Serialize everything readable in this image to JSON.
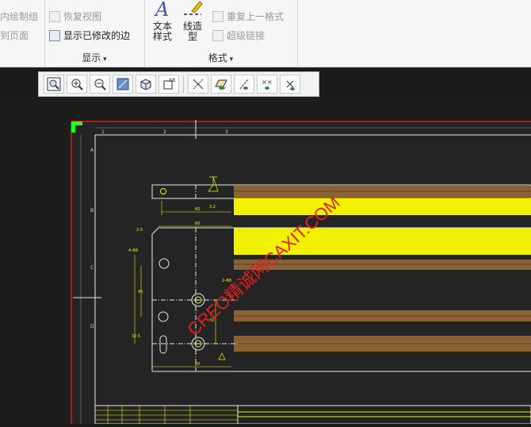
{
  "ribbon": {
    "left_items": [
      "内绘制组",
      "到页面"
    ],
    "display": {
      "label": "显示",
      "items": [
        "恢复视图",
        "显示已修改的边"
      ]
    },
    "format": {
      "label": "格式",
      "text_style": "文本\n样式",
      "line_type": "线造\n型",
      "items": [
        "重复上一格式",
        "超级链接"
      ]
    }
  },
  "view_toolbar": {
    "tools": [
      "zoom-fit-icon",
      "zoom-in-icon",
      "zoom-out-icon",
      "repaint-icon",
      "display-style-icon",
      "saved-views-icon",
      "datum-display-icon",
      "datum-plane-icon",
      "datum-axis-icon",
      "datum-point-icon",
      "coordinate-system-icon"
    ]
  },
  "drawing": {
    "border_numbers": [
      "1",
      "2",
      "3"
    ],
    "border_letters": [
      "A",
      "B",
      "C",
      "D"
    ],
    "dimensions": [
      "3.2",
      "60",
      "60",
      "4-Φ8",
      "2-5",
      "45",
      "32.5",
      "2-Φ8",
      "40",
      "60"
    ]
  },
  "watermark": "CREO精诚网CAXIT.COM",
  "colors": {
    "drawing_bg": "#222222",
    "highlight": "#f2f200",
    "wood": "#8a6233",
    "border_red": "#d02020",
    "line": "#e8e8e8",
    "dim": "#f2f200"
  }
}
